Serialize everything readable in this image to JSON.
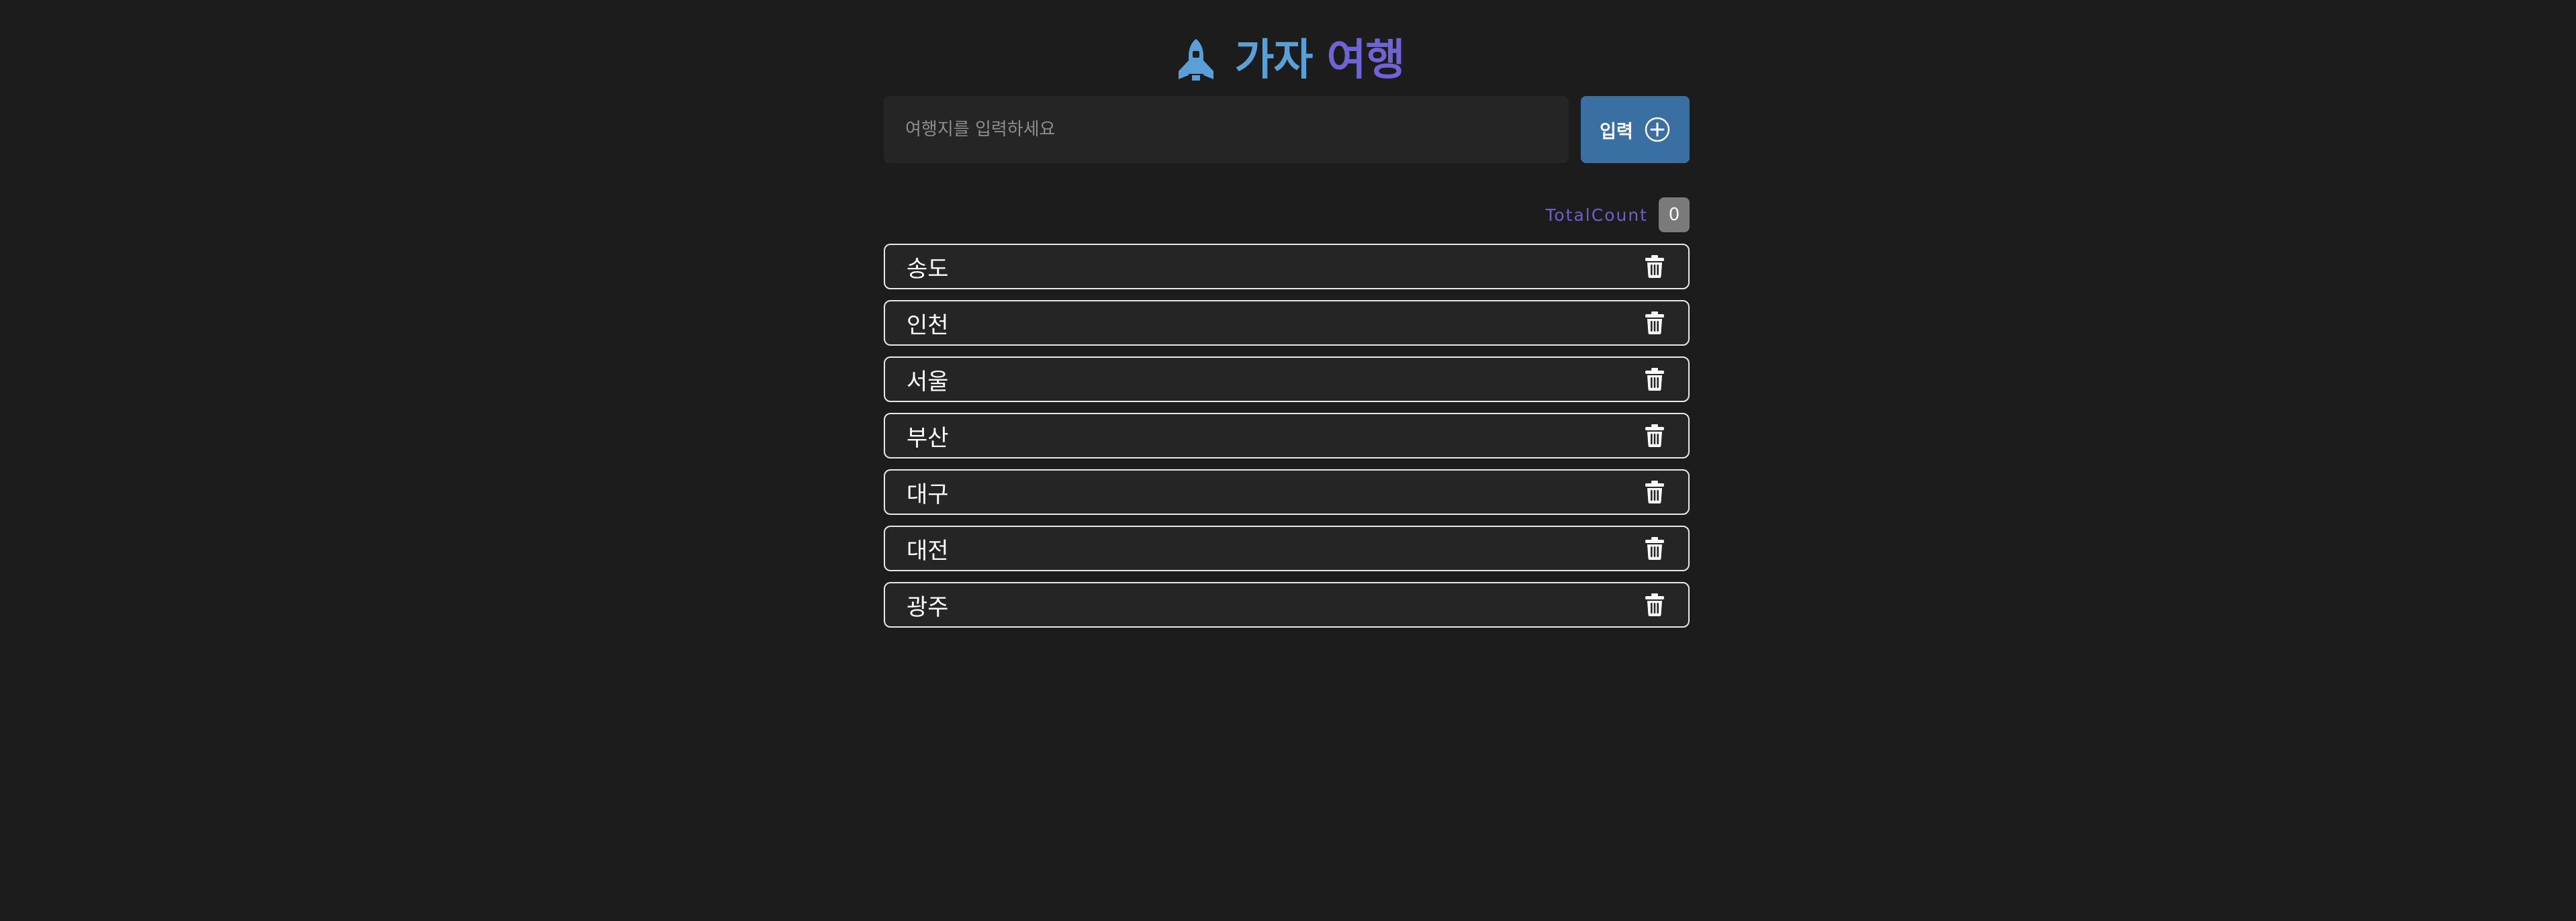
{
  "header": {
    "title_part1": "가자",
    "title_part2": "여행",
    "icon": "rocket-icon"
  },
  "form": {
    "placeholder": "여행지를 입력하세요",
    "value": "",
    "submit_label": "입력",
    "submit_icon": "plus-circle-icon"
  },
  "summary": {
    "label": "TotalCount",
    "count": "0"
  },
  "list": {
    "delete_icon": "trash-icon",
    "items": [
      {
        "label": "송도"
      },
      {
        "label": "인천"
      },
      {
        "label": "서울"
      },
      {
        "label": "부산"
      },
      {
        "label": "대구"
      },
      {
        "label": "대전"
      },
      {
        "label": "광주"
      }
    ]
  },
  "colors": {
    "background": "#1c1c1c",
    "panel": "#252525",
    "accent_blue": "#5a9fd8",
    "accent_purple": "#6f63d6",
    "button": "#3a6fa3"
  }
}
